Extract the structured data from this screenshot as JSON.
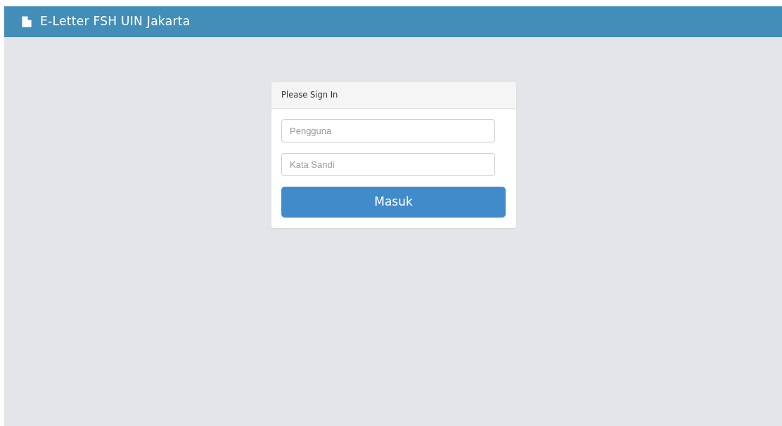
{
  "navbar": {
    "title": "E-Letter FSH UIN Jakarta"
  },
  "login_panel": {
    "heading": "Please Sign In",
    "fields": [
      {
        "placeholder": "Pengguna"
      },
      {
        "placeholder": "Kata Sandi"
      }
    ],
    "submit_button": "Masuk"
  }
}
